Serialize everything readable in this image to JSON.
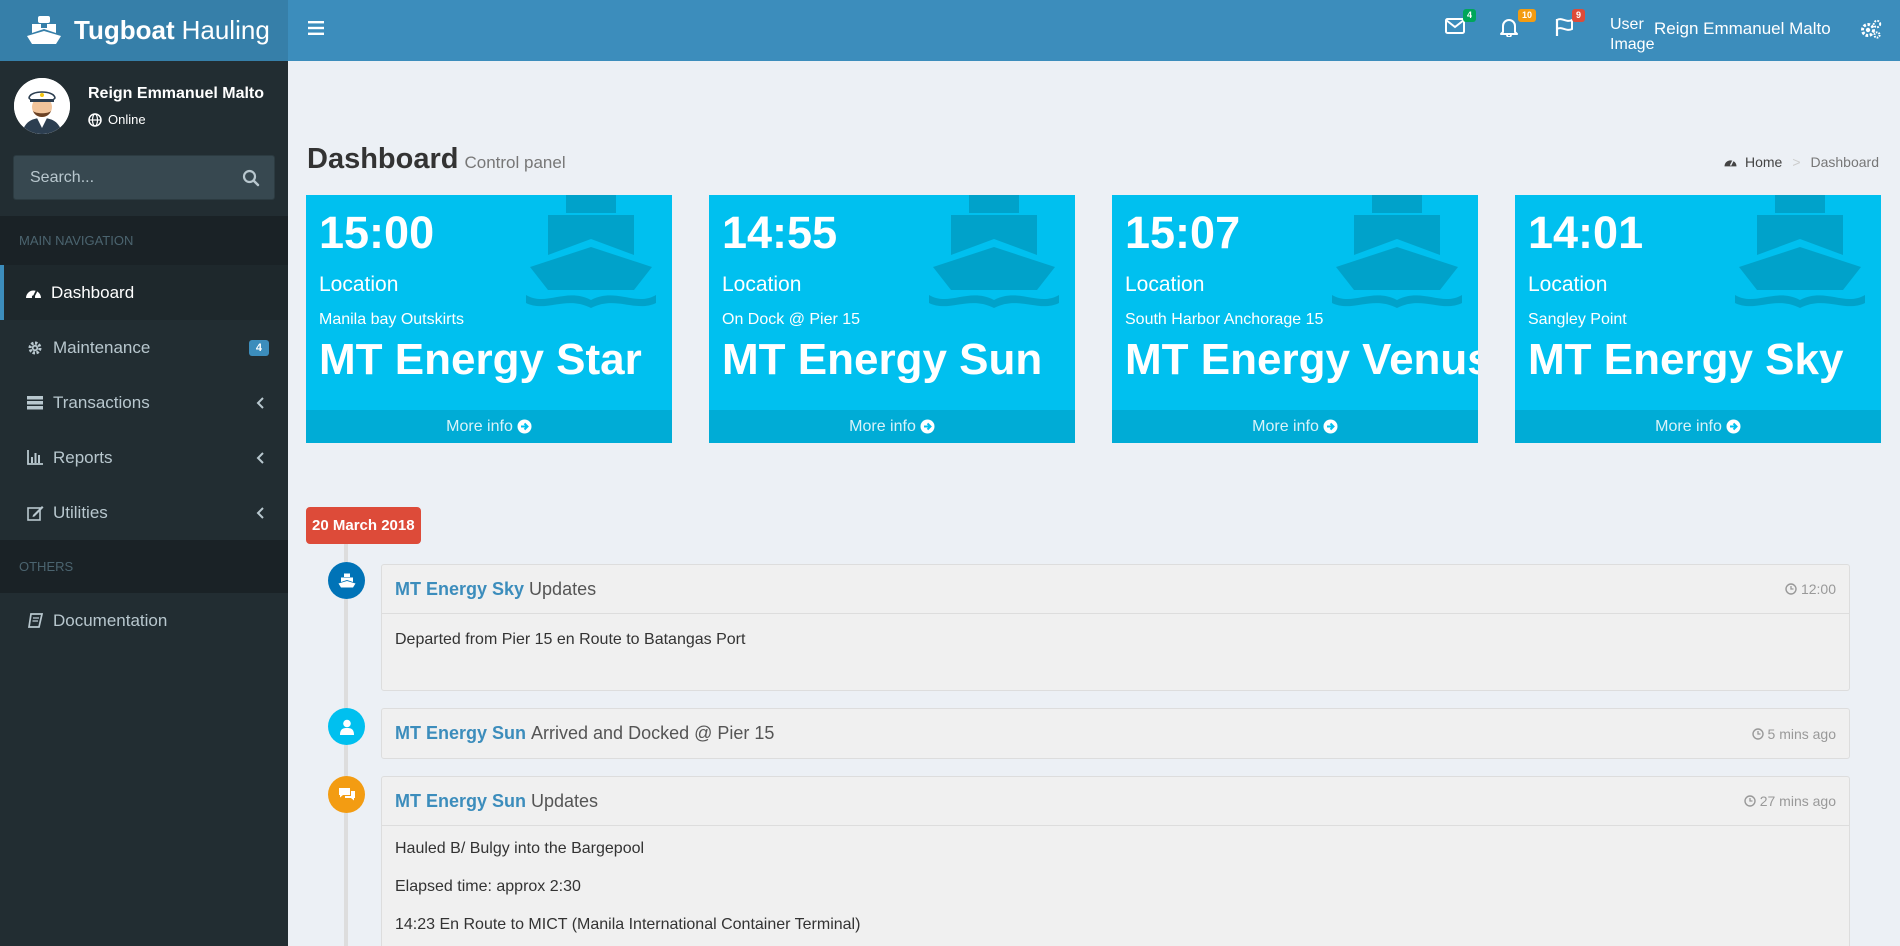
{
  "app": {
    "brand_bold": "Tugboat",
    "brand_light": "Hauling"
  },
  "sidebar": {
    "user_name": "Reign Emmanuel Malto",
    "user_status": "Online",
    "search_placeholder": "Search...",
    "header_main": "MAIN NAVIGATION",
    "header_others": "OTHERS",
    "items": [
      {
        "label": "Dashboard"
      },
      {
        "label": "Maintenance",
        "badge": "4"
      },
      {
        "label": "Transactions"
      },
      {
        "label": "Reports"
      },
      {
        "label": "Utilities"
      },
      {
        "label": "Documentation"
      }
    ]
  },
  "topbar": {
    "messages_count": "4",
    "notifications_count": "10",
    "tasks_count": "9",
    "user_image_alt": "User Image",
    "user_name": "Reign Emmanuel Malto"
  },
  "page": {
    "title": "Dashboard",
    "subtitle": "Control panel",
    "breadcrumb_home": "Home",
    "breadcrumb_current": "Dashboard"
  },
  "cards": [
    {
      "time": "15:00",
      "location_label": "Location",
      "place": "Manila bay Outskirts",
      "vessel": "MT Energy Star",
      "more": "More info"
    },
    {
      "time": "14:55",
      "location_label": "Location",
      "place": "On Dock @ Pier 15",
      "vessel": "MT Energy Sun",
      "more": "More info"
    },
    {
      "time": "15:07",
      "location_label": "Location",
      "place": "South Harbor Anchorage 15",
      "vessel": "MT Energy Venus",
      "more": "More info"
    },
    {
      "time": "14:01",
      "location_label": "Location",
      "place": "Sangley Point",
      "vessel": "MT Energy Sky",
      "more": "More info"
    }
  ],
  "timeline": {
    "date": "20 March 2018",
    "items": [
      {
        "who": "MT Energy Sky",
        "what": "Updates",
        "when": "12:00",
        "body": [
          "Departed from Pier 15 en Route to Batangas Port"
        ]
      },
      {
        "who": "MT Energy Sun",
        "what": "Arrived and Docked @ Pier 15",
        "when": "5 mins ago",
        "body": []
      },
      {
        "who": "MT Energy Sun",
        "what": "Updates",
        "when": "27 mins ago",
        "body": [
          "Hauled B/ Bulgy into the Bargepool",
          "Elapsed time: approx 2:30",
          "14:23 En Route to MICT (Manila International Container Terminal)"
        ]
      }
    ]
  },
  "colors": {
    "sidebar_bg": "#222d32",
    "header_bg": "#3c8dbc",
    "logo_bg": "#367fa9",
    "card_bg": "#00c0ef",
    "date_label_bg": "#dd4b39",
    "badge_green": "#00a65a",
    "badge_yellow": "#f39c12",
    "badge_red": "#dd4b39"
  }
}
